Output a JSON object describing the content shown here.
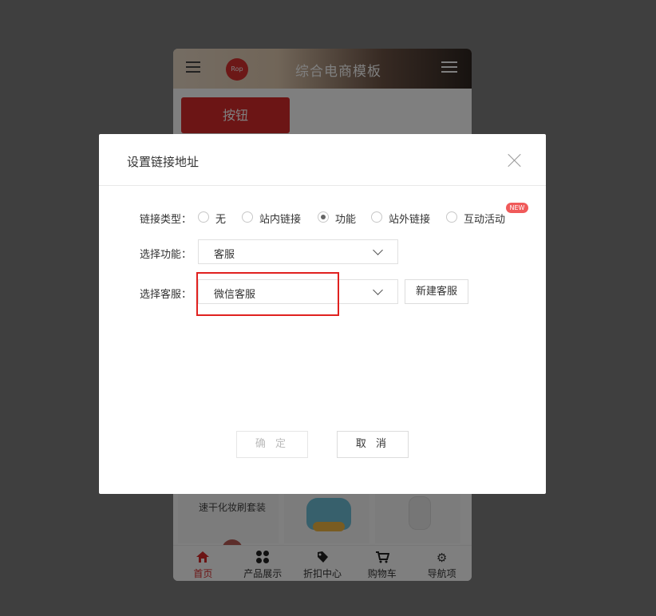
{
  "phone": {
    "header": {
      "logo_text": "Rop",
      "title": "综合电商模板"
    },
    "button_label": "按钮",
    "products": {
      "card1_subtitle": "速干化妆刷套装"
    },
    "tabbar": [
      {
        "label": "首页",
        "icon": "home-icon",
        "active": true
      },
      {
        "label": "产品展示",
        "icon": "grid-icon",
        "active": false
      },
      {
        "label": "折扣中心",
        "icon": "tag-icon",
        "active": false
      },
      {
        "label": "购物车",
        "icon": "cart-icon",
        "active": false
      },
      {
        "label": "导航项",
        "icon": "gear-icon",
        "active": false
      }
    ]
  },
  "dialog": {
    "title": "设置链接地址",
    "link_type": {
      "label": "链接类型：",
      "options": [
        "无",
        "站内链接",
        "功能",
        "站外链接",
        "互动活动"
      ],
      "selected": "功能",
      "new_badge": "NEW"
    },
    "function_select": {
      "label": "选择功能：",
      "value": "客服"
    },
    "service_select": {
      "label": "选择客服：",
      "value": "微信客服",
      "new_button": "新建客服"
    },
    "confirm_label": "确 定",
    "cancel_label": "取 消"
  },
  "colors": {
    "accent_red": "#d82b2b",
    "highlight_red": "#e0211f",
    "overlay": "rgba(0,0,0,0.5)"
  }
}
